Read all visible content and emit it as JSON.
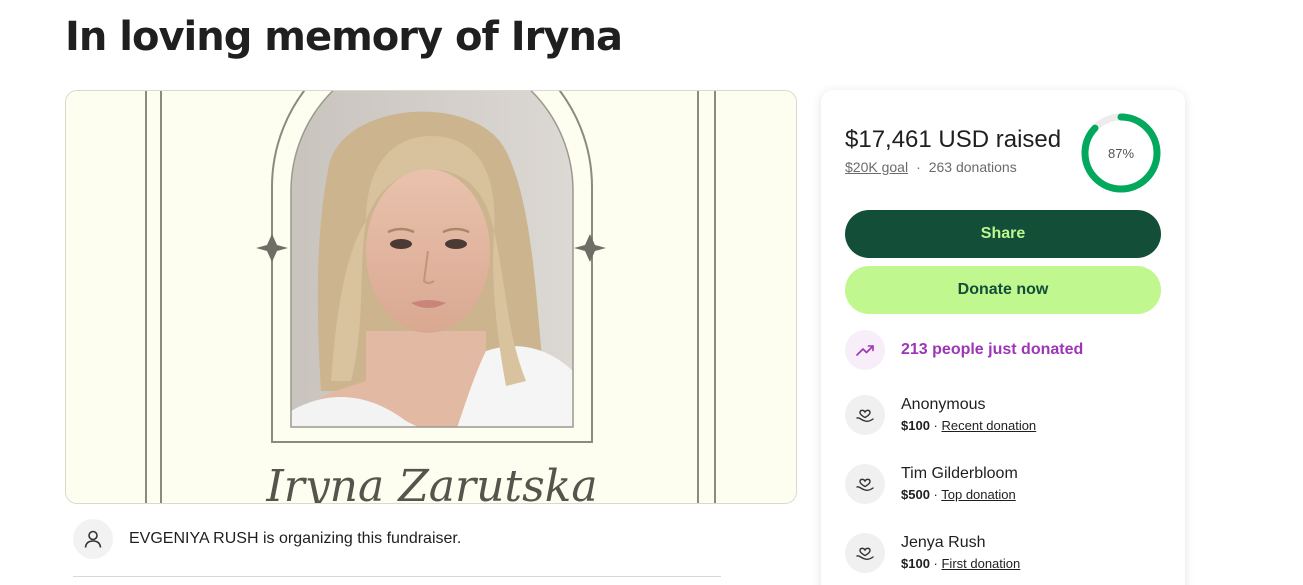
{
  "page": {
    "title": "In loving memory of Iryna"
  },
  "hero": {
    "name_text": "Iryna Zarutska",
    "image_alt": "memorial portrait"
  },
  "organizer": {
    "text": "EVGENIYA RUSH is organizing this fundraiser."
  },
  "donation": {
    "raised": "$17,461 USD raised",
    "goal": "$20K goal",
    "separator": "·",
    "count": "263 donations",
    "progress_label": "87%",
    "progress_fraction": 0.87,
    "share_label": "Share",
    "donate_label": "Donate now",
    "trend_text": "213 people just donated"
  },
  "donors": [
    {
      "name": "Anonymous",
      "amount": "$100",
      "tag": "Recent donation"
    },
    {
      "name": "Tim Gilderbloom",
      "amount": "$500",
      "tag": "Top donation"
    },
    {
      "name": "Jenya Rush",
      "amount": "$100",
      "tag": "First donation"
    }
  ],
  "colors": {
    "share_bg": "#124e38",
    "share_text": "#bdf78e",
    "donate_bg": "#c0f78f",
    "progress": "#02a95c",
    "trend": "#9c36b5"
  }
}
